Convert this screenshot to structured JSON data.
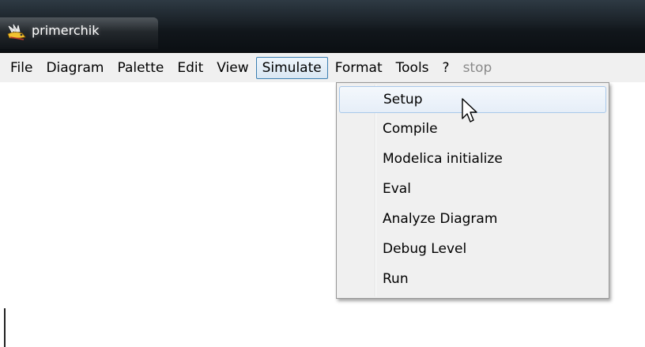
{
  "window": {
    "title": "primerchik"
  },
  "menubar": {
    "items": [
      {
        "label": "File"
      },
      {
        "label": "Diagram"
      },
      {
        "label": "Palette"
      },
      {
        "label": "Edit"
      },
      {
        "label": "View"
      },
      {
        "label": "Simulate"
      },
      {
        "label": "Format"
      },
      {
        "label": "Tools"
      },
      {
        "label": "?"
      },
      {
        "label": "stop"
      }
    ],
    "active_item": "Simulate",
    "disabled_item": "stop"
  },
  "simulate_menu": {
    "items": [
      {
        "label": "Setup"
      },
      {
        "label": "Compile"
      },
      {
        "label": "Modelica initialize"
      },
      {
        "label": "Eval"
      },
      {
        "label": "Analyze Diagram"
      },
      {
        "label": "Debug Level"
      },
      {
        "label": "Run"
      }
    ],
    "highlighted_item": "Setup"
  },
  "icons": {
    "app": "scicos-app-icon",
    "pointer": "mouse-pointer-icon"
  },
  "colors": {
    "titlebar": "#11161b",
    "menubar": "#f0f0f0",
    "active_menu_border": "#3c7fb1",
    "highlight_border": "#a8c8ea",
    "disabled_text": "#8a8a8a"
  }
}
